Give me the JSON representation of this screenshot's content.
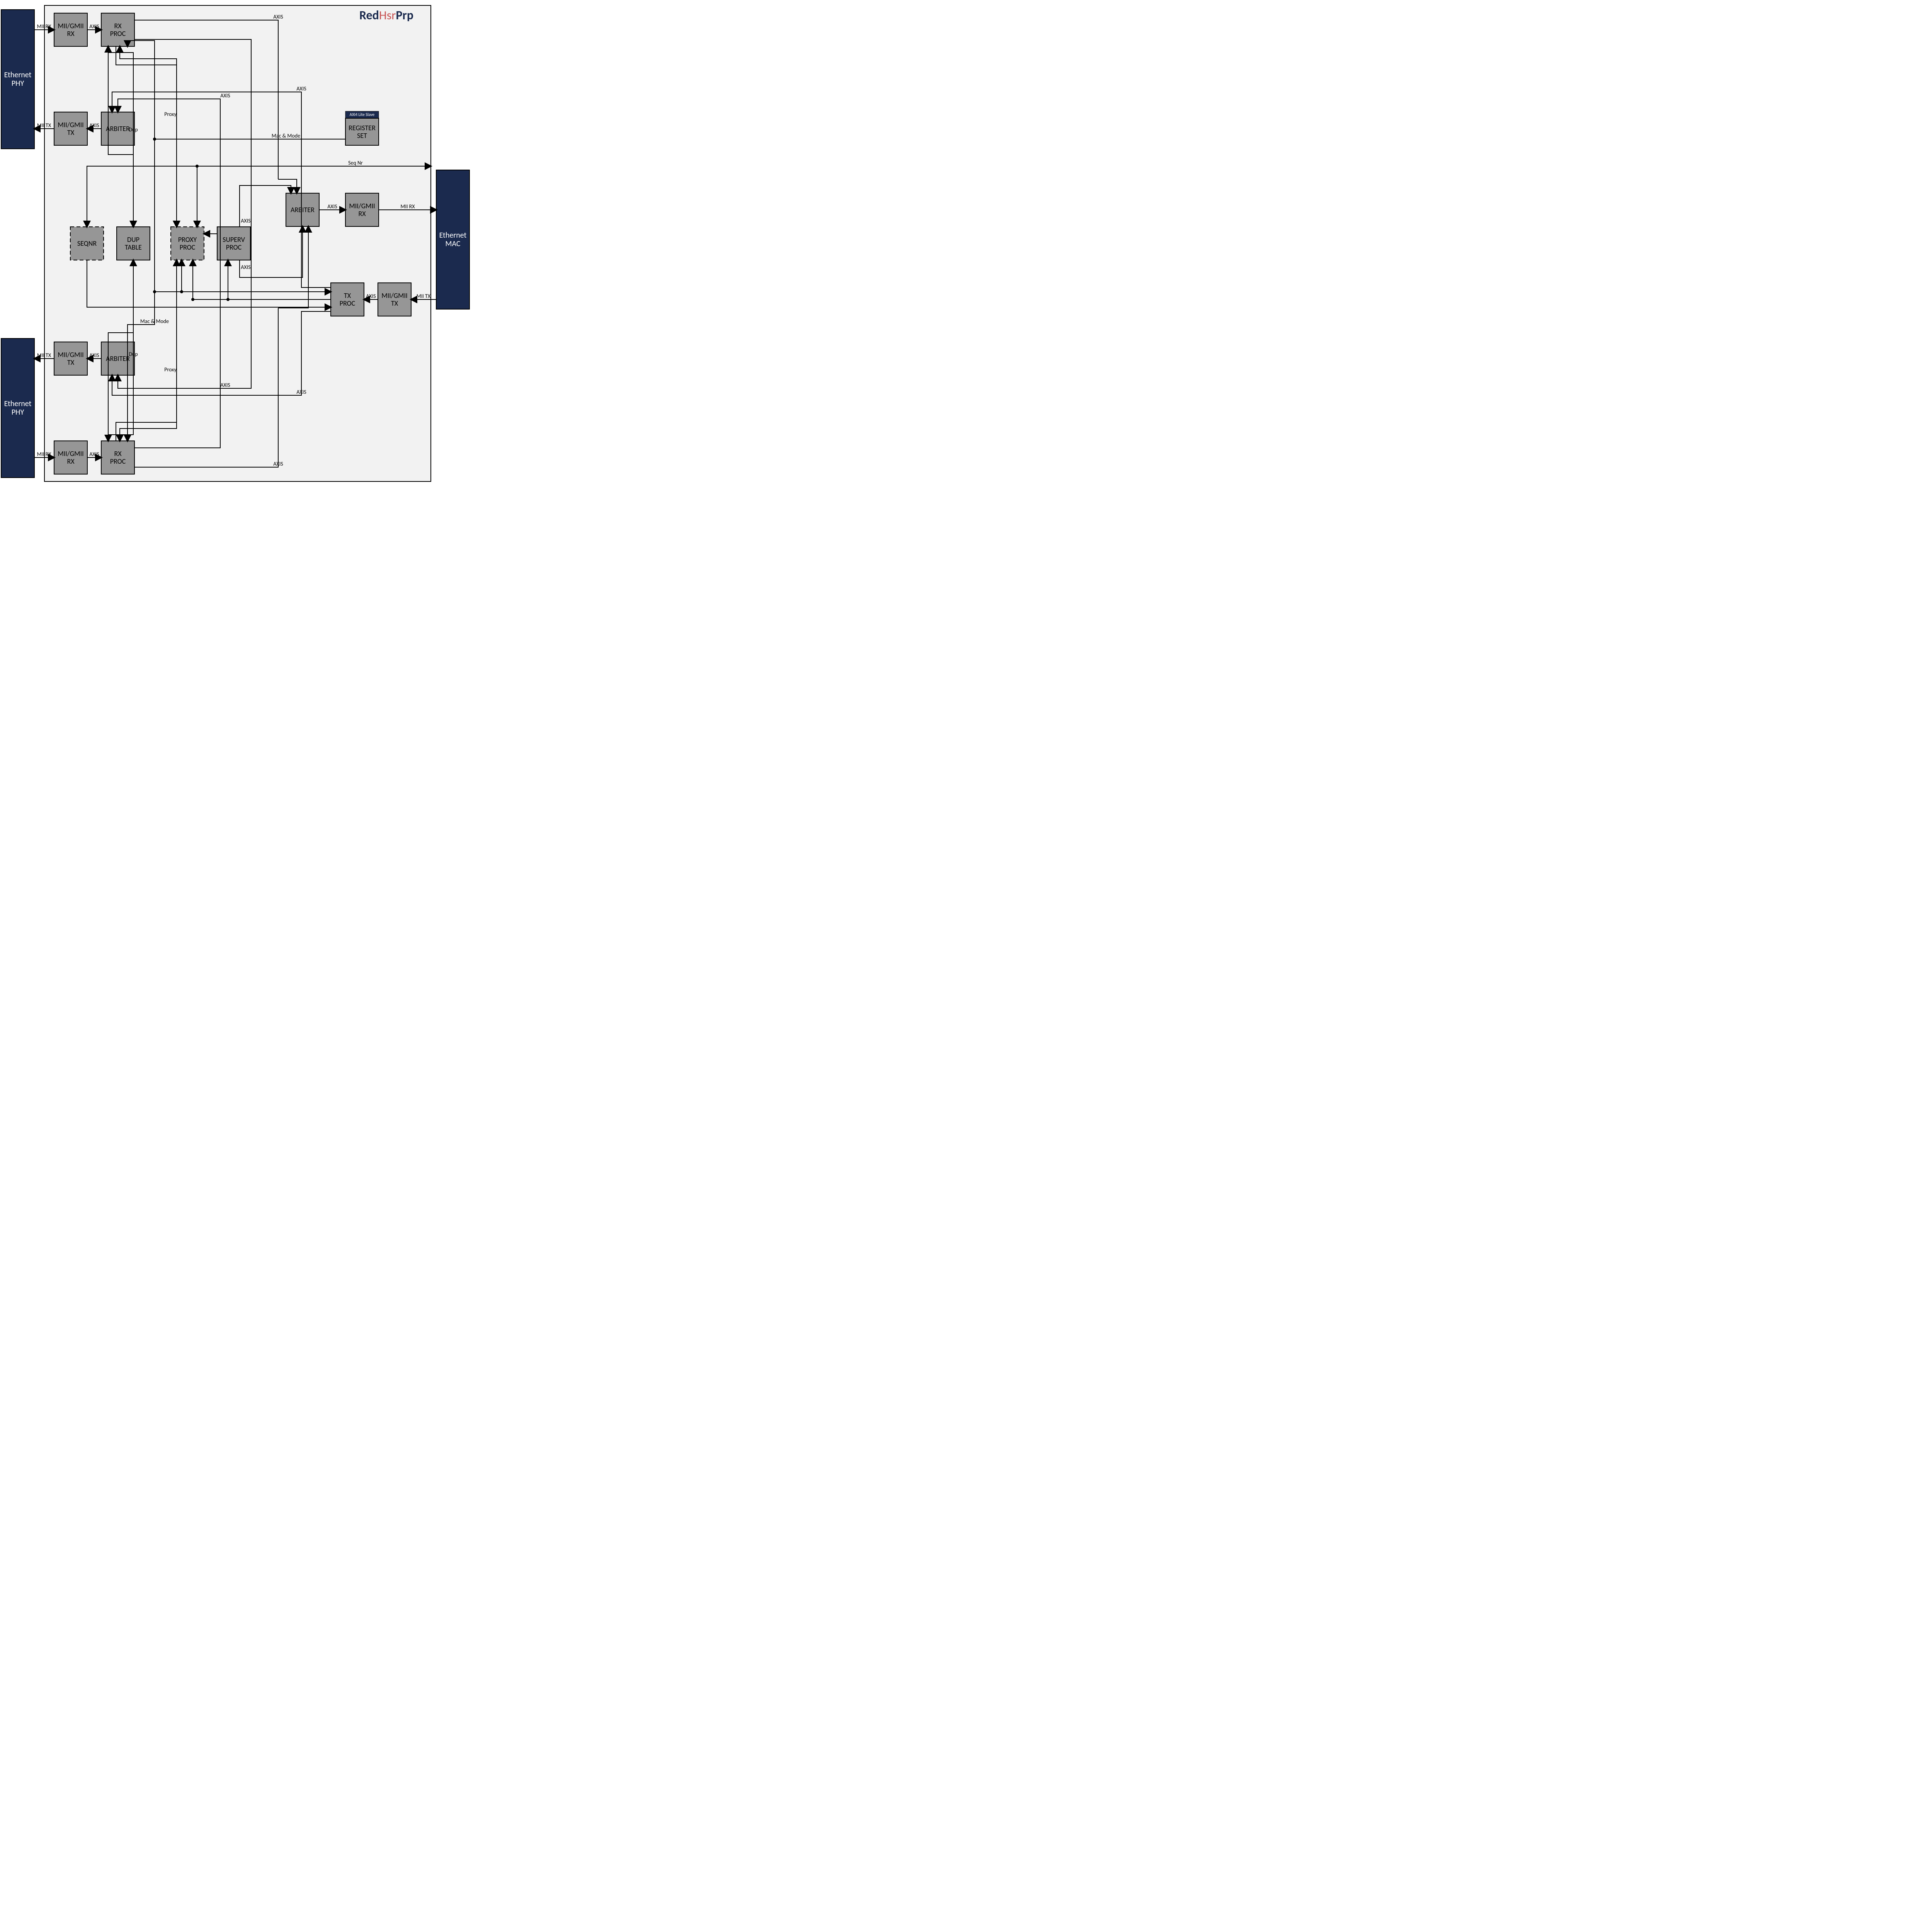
{
  "logo": {
    "part1": "Red",
    "part2": "Hsr",
    "part3": "Prp"
  },
  "ext": {
    "phy1": "Ethernet\nPHY",
    "phy2": "Ethernet\nPHY",
    "mac": "Ethernet\nMAC"
  },
  "ext_labels": {
    "mii_rx": "MII RX",
    "mii_tx": "MII TX"
  },
  "blocks": {
    "mii_rx_a": "MII/GMII\nRX",
    "mii_tx_a": "MII/GMII\nTX",
    "mii_rx_b": "MII/GMII\nRX",
    "mii_tx_b": "MII/GMII\nTX",
    "mii_rx_c": "MII/GMII\nRX",
    "mii_tx_c": "MII/GMII\nTX",
    "rx_proc_a": "RX\nPROC",
    "rx_proc_b": "RX\nPROC",
    "tx_proc": "TX\nPROC",
    "arbiter_a": "ARBITER",
    "arbiter_b": "ARBITER",
    "arbiter_c": "ARBITER",
    "seqnr": "SEQNR",
    "dup": "DUP\nTABLE",
    "proxy": "PROXY\nPROC",
    "superv": "SUPERV\nPROC",
    "reg_hdr": "AXI4 Lite Slave",
    "reg": "REGISTER\nSET"
  },
  "signals": {
    "axis": "AXIS",
    "dup": "Dup",
    "proxy": "Proxy",
    "macmode": "Mac & Mode",
    "seqnr": "Seq Nr"
  }
}
